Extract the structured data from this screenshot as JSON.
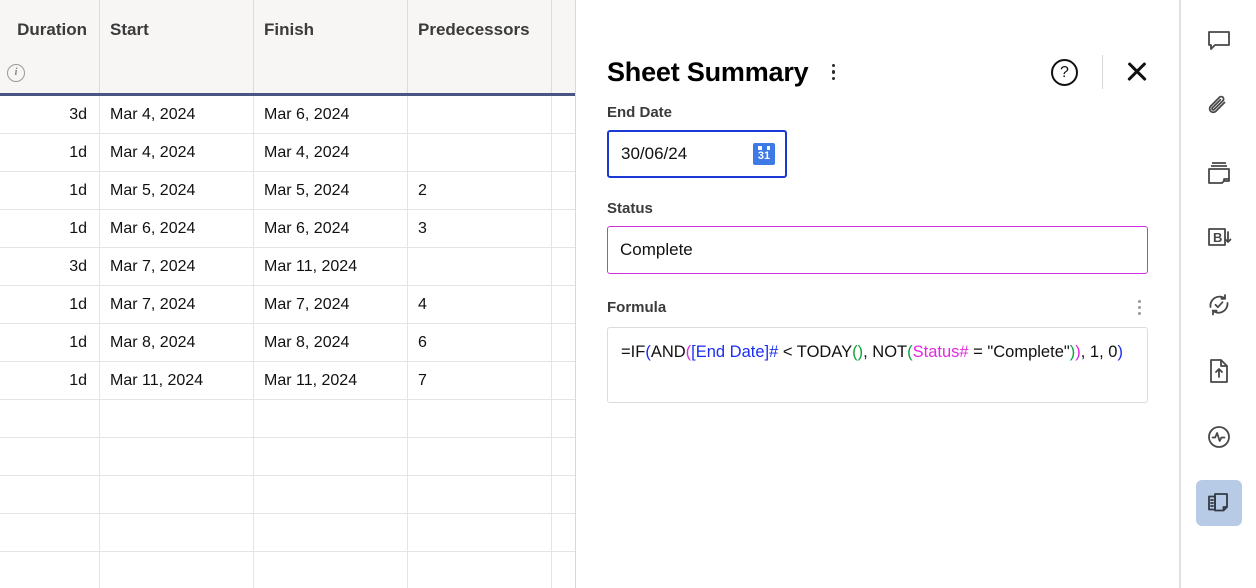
{
  "grid": {
    "columns": [
      {
        "key": "duration",
        "label": "Duration",
        "has_info_icon": true
      },
      {
        "key": "start",
        "label": "Start",
        "has_info_icon": false
      },
      {
        "key": "finish",
        "label": "Finish",
        "has_info_icon": false
      },
      {
        "key": "predecessors",
        "label": "Predecessors",
        "has_info_icon": false
      }
    ],
    "rows": [
      {
        "duration": "3d",
        "start": "Mar 4, 2024",
        "finish": "Mar 6, 2024",
        "predecessors": ""
      },
      {
        "duration": "1d",
        "start": "Mar 4, 2024",
        "finish": "Mar 4, 2024",
        "predecessors": ""
      },
      {
        "duration": "1d",
        "start": "Mar 5, 2024",
        "finish": "Mar 5, 2024",
        "predecessors": "2"
      },
      {
        "duration": "1d",
        "start": "Mar 6, 2024",
        "finish": "Mar 6, 2024",
        "predecessors": "3"
      },
      {
        "duration": "3d",
        "start": "Mar 7, 2024",
        "finish": "Mar 11, 2024",
        "predecessors": ""
      },
      {
        "duration": "1d",
        "start": "Mar 7, 2024",
        "finish": "Mar 7, 2024",
        "predecessors": "4"
      },
      {
        "duration": "1d",
        "start": "Mar 8, 2024",
        "finish": "Mar 8, 2024",
        "predecessors": "6"
      },
      {
        "duration": "1d",
        "start": "Mar 11, 2024",
        "finish": "Mar 11, 2024",
        "predecessors": "7"
      },
      {
        "duration": "",
        "start": "",
        "finish": "",
        "predecessors": ""
      },
      {
        "duration": "",
        "start": "",
        "finish": "",
        "predecessors": ""
      },
      {
        "duration": "",
        "start": "",
        "finish": "",
        "predecessors": ""
      },
      {
        "duration": "",
        "start": "",
        "finish": "",
        "predecessors": ""
      },
      {
        "duration": "",
        "start": "",
        "finish": "",
        "predecessors": ""
      }
    ]
  },
  "panel": {
    "title": "Sheet Summary",
    "menu_icon": "kebab-menu-icon",
    "help_icon": "help-circle-icon",
    "close_icon": "close-x-icon",
    "end_date": {
      "label": "End Date",
      "value": "30/06/24",
      "placeholder": "dd/mm/yy",
      "calendar_icon_day": "31",
      "border_color": "#1a39d4",
      "calendar_icon_color": "#3d7ae5"
    },
    "status": {
      "label": "Status",
      "value": "Complete",
      "placeholder": "",
      "border_color": "#d033dd"
    },
    "formula": {
      "label": "Formula",
      "menu_icon": "kebab-menu-icon",
      "text": "=IF(AND([End Date]# < TODAY(), NOT(Status# = \"Complete\")), 1, 0)",
      "tokens": [
        {
          "t": "=IF",
          "c": "black"
        },
        {
          "t": "(",
          "c": "blue"
        },
        {
          "t": "AND",
          "c": "black"
        },
        {
          "t": "(",
          "c": "mag"
        },
        {
          "t": "[End Date]#",
          "c": "blue"
        },
        {
          "t": " < TODAY",
          "c": "black"
        },
        {
          "t": "()",
          "c": "green"
        },
        {
          "t": ", NOT",
          "c": "black"
        },
        {
          "t": "(",
          "c": "green"
        },
        {
          "t": "Status#",
          "c": "mag"
        },
        {
          "t": " = \"Complete\"",
          "c": "black"
        },
        {
          "t": ")",
          "c": "green"
        },
        {
          "t": ")",
          "c": "mag"
        },
        {
          "t": ", 1, 0",
          "c": "black"
        },
        {
          "t": ")",
          "c": "blue"
        }
      ]
    }
  },
  "toolbar": {
    "items": [
      {
        "name": "comments-icon",
        "label": "Comments",
        "active": false
      },
      {
        "name": "attachments-icon",
        "label": "Attachments",
        "active": false
      },
      {
        "name": "proof-icon",
        "label": "Proofs",
        "active": false
      },
      {
        "name": "brandfolder-icon",
        "label": "Brandfolder",
        "active": false
      },
      {
        "name": "update-request-icon",
        "label": "Update Requests",
        "active": false
      },
      {
        "name": "publish-icon",
        "label": "Publish",
        "active": false
      },
      {
        "name": "activity-log-icon",
        "label": "Activity Log",
        "active": false
      },
      {
        "name": "sheet-summary-icon",
        "label": "Sheet Summary",
        "active": true
      }
    ],
    "active_bg": "#b7cbe6"
  }
}
